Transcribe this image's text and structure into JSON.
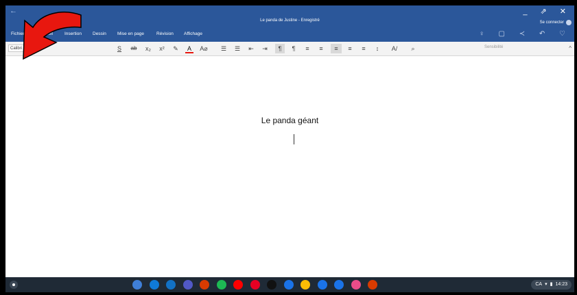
{
  "titlebar": {
    "back_icon": "←",
    "doc_title": "Le panda de Justine - Enregistré",
    "window_controls": "_ ⇗ ✕",
    "signin_label": "Se connecter"
  },
  "menu": {
    "tabs": [
      "Fichier",
      "Accueil",
      "Insertion",
      "Dessin",
      "Mise en page",
      "Révision",
      "Affichage"
    ],
    "right_icons": "♀ ▢ ≺ ↶ ♡"
  },
  "ribbon": {
    "font_name": "Calibri (C",
    "sensitivity_label": "Sensibilité",
    "collapse_icon": "^"
  },
  "document": {
    "heading": "Le panda géant"
  },
  "shelf": {
    "tray_locale": "CA",
    "tray_time": "14:23",
    "apps": [
      {
        "name": "app-grid",
        "color": "#3f7fd8"
      },
      {
        "name": "onedrive",
        "color": "#0f7ad8"
      },
      {
        "name": "outlook",
        "color": "#1271c4"
      },
      {
        "name": "teams",
        "color": "#5159c6"
      },
      {
        "name": "office",
        "color": "#d83b01"
      },
      {
        "name": "spotify",
        "color": "#1db954"
      },
      {
        "name": "youtube",
        "color": "#ff0000"
      },
      {
        "name": "pinterest",
        "color": "#e60023"
      },
      {
        "name": "netflix",
        "color": "#111111"
      },
      {
        "name": "play",
        "color": "#1a73e8"
      },
      {
        "name": "chrome",
        "color": "#fbbc05"
      },
      {
        "name": "files",
        "color": "#1a73e8"
      },
      {
        "name": "settings",
        "color": "#1a73e8"
      },
      {
        "name": "camera",
        "color": "#ea4c89"
      },
      {
        "name": "office-2",
        "color": "#d83b01"
      }
    ]
  },
  "colors": {
    "word_blue": "#2b579a",
    "annotation_red": "#e8170f"
  }
}
